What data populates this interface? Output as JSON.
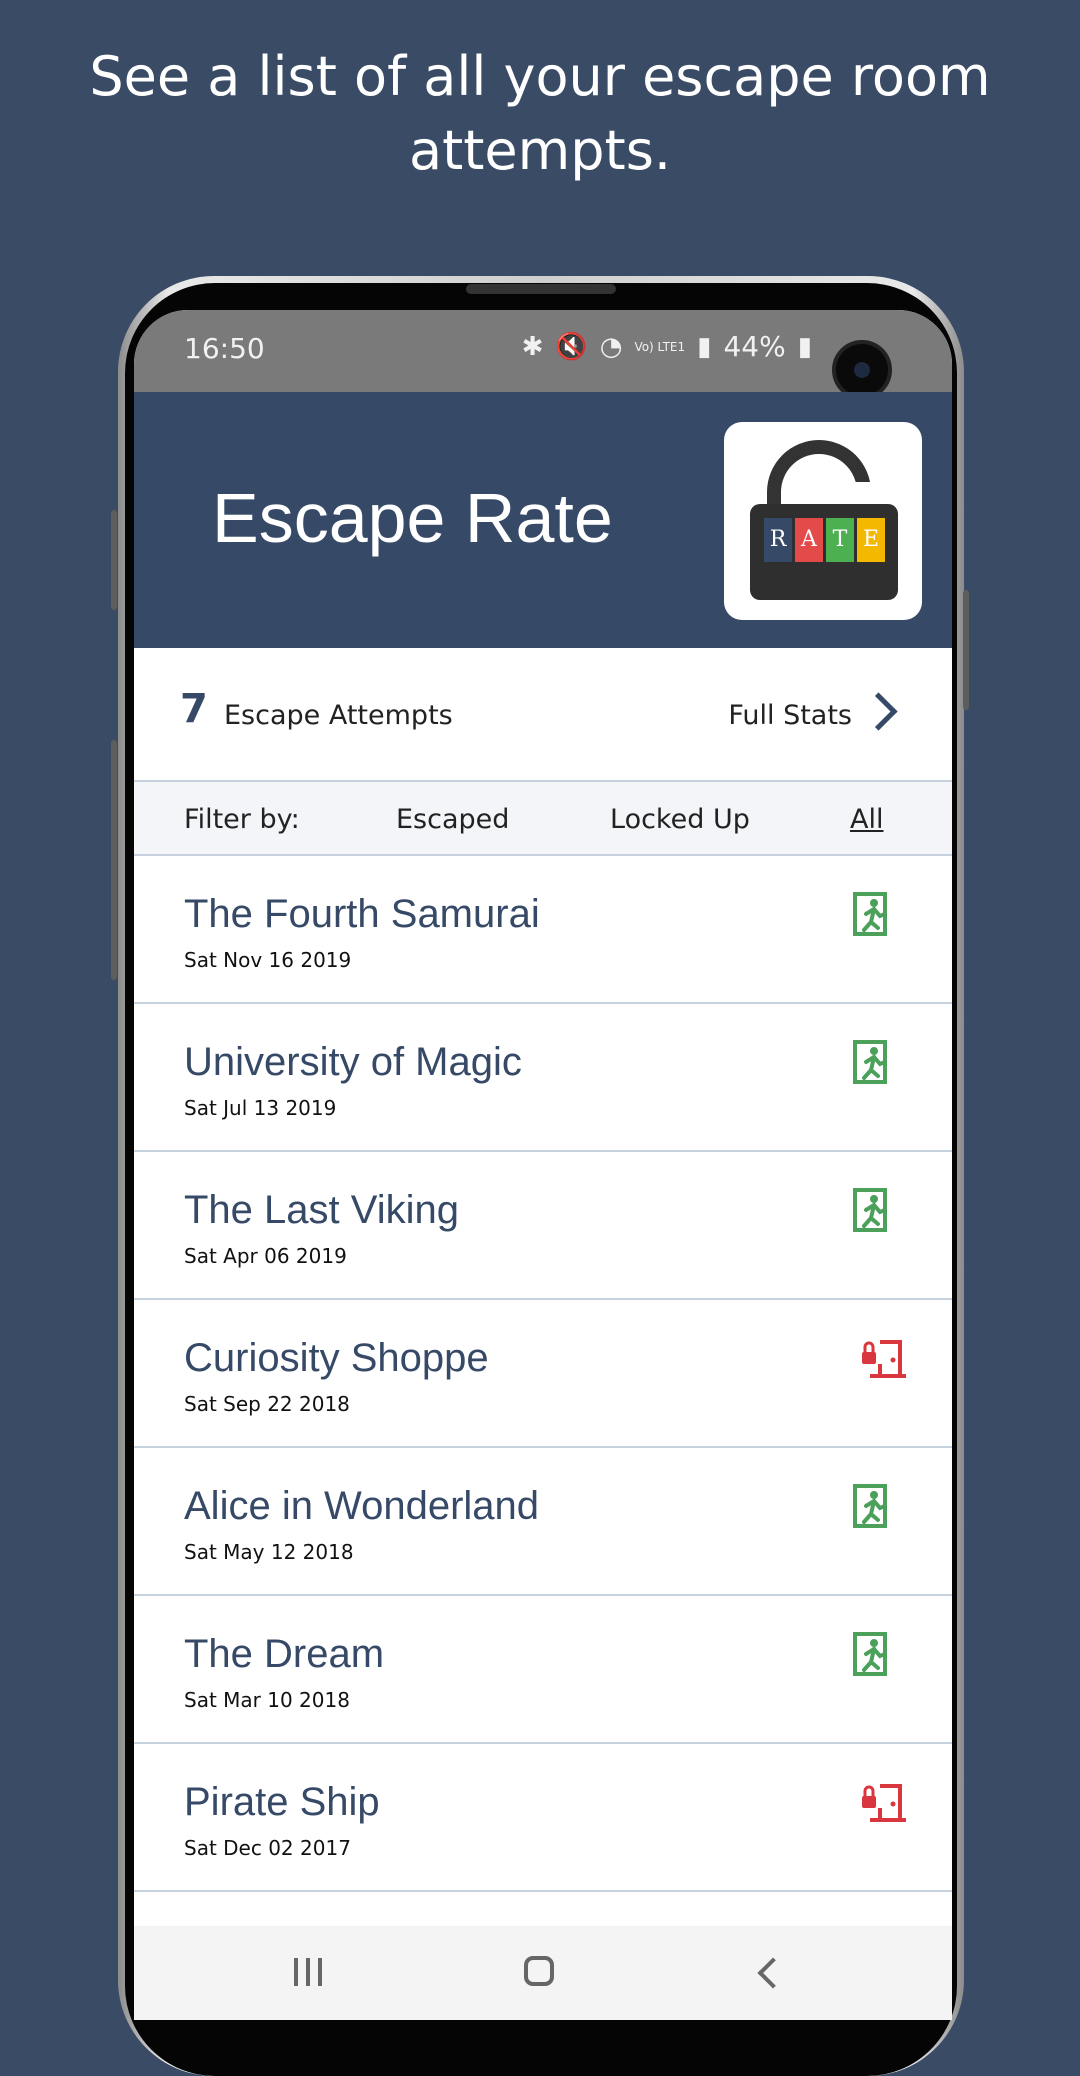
{
  "headline": "See a list of all your escape room attempts.",
  "status_bar": {
    "time": "16:50",
    "battery": "44%",
    "signal": "Vo) LTE1"
  },
  "app": {
    "title": "Escape Rate",
    "logo_letters": [
      "R",
      "A",
      "T",
      "E"
    ],
    "logo_colors": [
      "#364967",
      "#e34b4b",
      "#4caf50",
      "#f5b800"
    ]
  },
  "summary": {
    "count": "7",
    "count_label": "Escape Attempts",
    "full_stats": "Full Stats"
  },
  "filter": {
    "label": "Filter by:",
    "escaped": "Escaped",
    "locked_up": "Locked Up",
    "all": "All"
  },
  "colors": {
    "escaped": "#4ba05a",
    "locked": "#d9363e",
    "header": "#364967"
  },
  "rooms": [
    {
      "name": "The Fourth Samurai",
      "date": "Sat Nov 16 2019",
      "status": "escaped",
      "icon": "escaped-runner-icon"
    },
    {
      "name": "University of Magic",
      "date": "Sat Jul 13 2019",
      "status": "escaped",
      "icon": "escaped-runner-icon"
    },
    {
      "name": "The Last Viking",
      "date": "Sat Apr 06 2019",
      "status": "escaped",
      "icon": "escaped-runner-icon"
    },
    {
      "name": "Curiosity Shoppe",
      "date": "Sat Sep 22 2018",
      "status": "locked",
      "icon": "locked-door-icon"
    },
    {
      "name": "Alice in Wonderland",
      "date": "Sat May 12 2018",
      "status": "escaped",
      "icon": "escaped-runner-icon"
    },
    {
      "name": "The Dream",
      "date": "Sat Mar 10 2018",
      "status": "escaped",
      "icon": "escaped-runner-icon"
    },
    {
      "name": "Pirate Ship",
      "date": "Sat Dec 02 2017",
      "status": "locked",
      "icon": "locked-door-icon"
    }
  ]
}
